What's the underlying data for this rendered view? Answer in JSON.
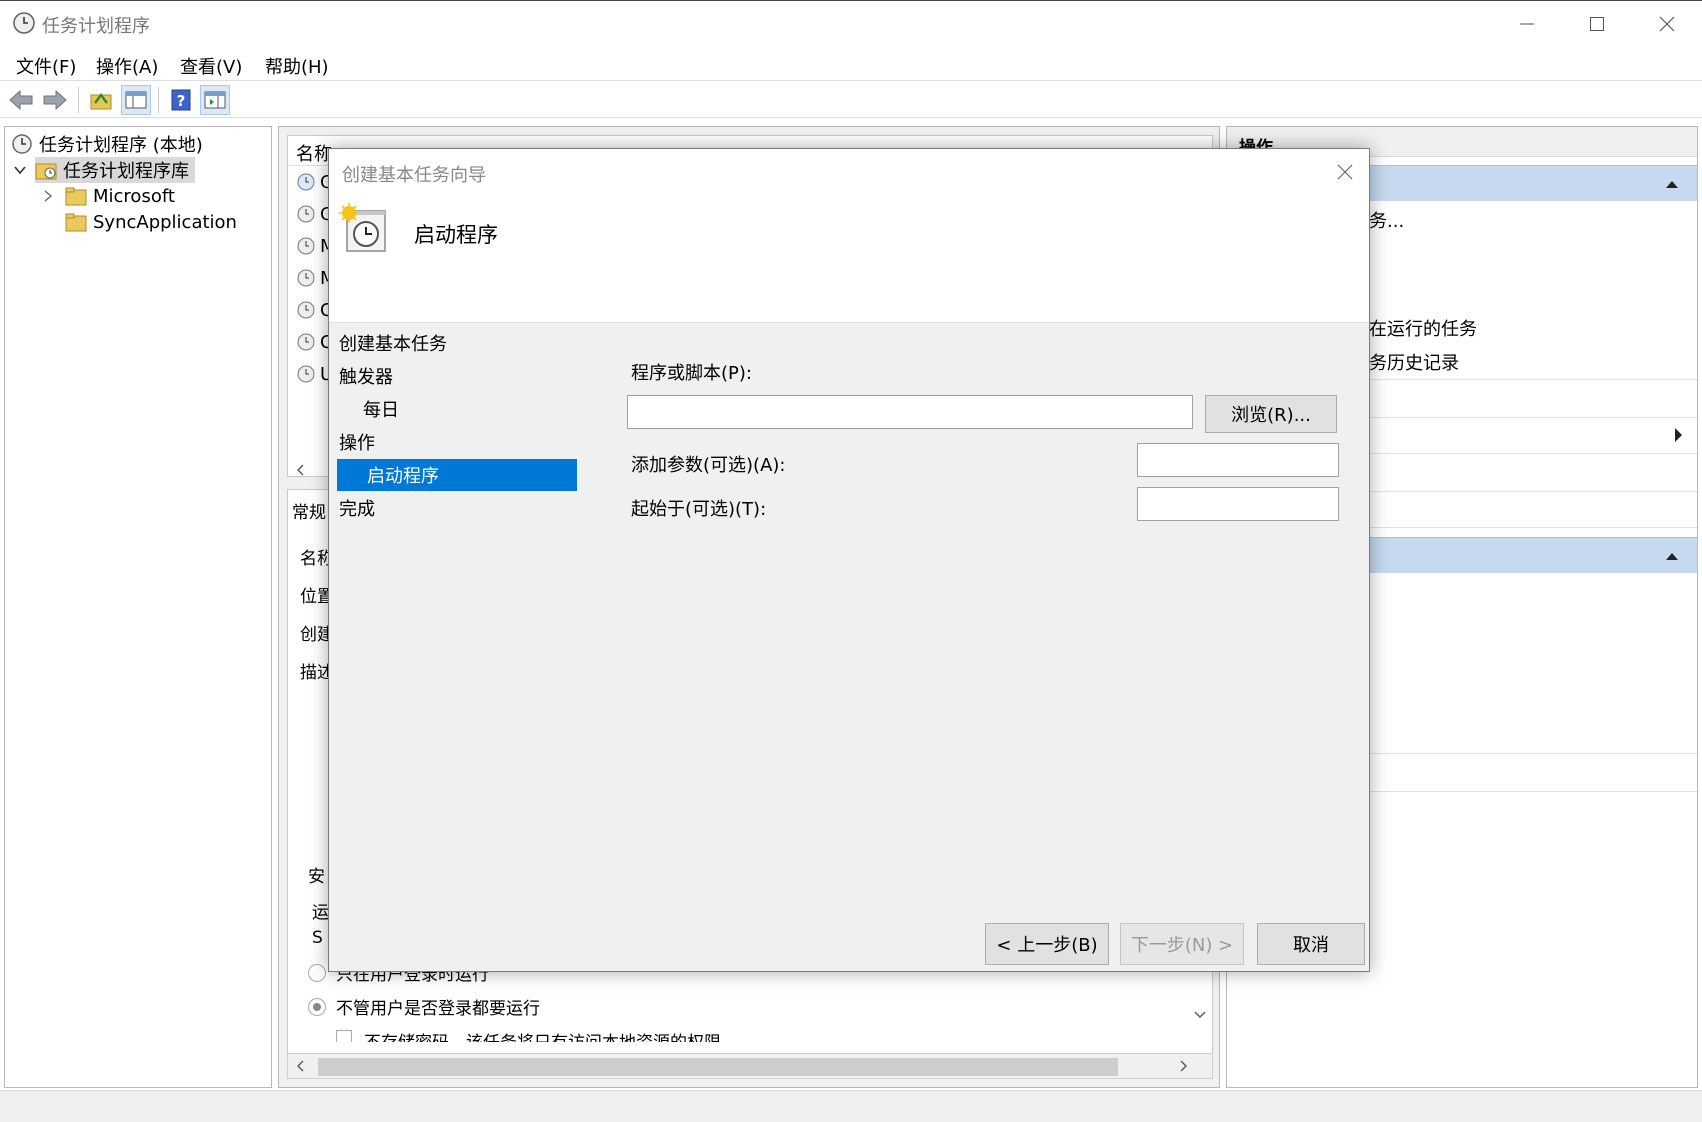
{
  "window": {
    "title": "任务计划程序"
  },
  "menu": [
    "文件(F)",
    "操作(A)",
    "查看(V)",
    "帮助(H)"
  ],
  "tree": {
    "root": "任务计划程序 (本地)",
    "library": "任务计划程序库",
    "children": [
      "Microsoft",
      "SyncApplication"
    ]
  },
  "list": {
    "header_name": "名称",
    "row_letters": [
      "G",
      "G",
      "M",
      "M",
      "C",
      "C",
      "U"
    ]
  },
  "detail": {
    "tab_general": "常规",
    "labels": [
      "名称",
      "位置",
      "创建",
      "描述"
    ],
    "security_label": "安",
    "run_label": "运",
    "s_label": "S",
    "radio_logged_on": "只在用户登录时运行",
    "radio_always": "不管用户是否登录都要运行",
    "checkbox_nopwd": "不存储密码。该任务将只有访问本地资源的权限"
  },
  "actions": {
    "header": "操作",
    "item_create": "务...",
    "item_running": "在运行的任务",
    "item_history": "务历史记录"
  },
  "dialog": {
    "title": "创建基本任务向导",
    "heading": "启动程序",
    "steps": {
      "create": "创建基本任务",
      "trigger": "触发器",
      "daily": "每日",
      "action": "操作",
      "start_program": "启动程序",
      "finish": "完成"
    },
    "program_label": "程序或脚本(P):",
    "program_value": "",
    "browse": "浏览(R)...",
    "args_label": "添加参数(可选)(A):",
    "args_value": "",
    "startin_label": "起始于(可选)(T):",
    "startin_value": "",
    "back": "< 上一步(B)",
    "next": "下一步(N) >",
    "cancel": "取消"
  },
  "colors": {
    "accent": "#0078d7",
    "group_header": "#c6d9ee"
  }
}
